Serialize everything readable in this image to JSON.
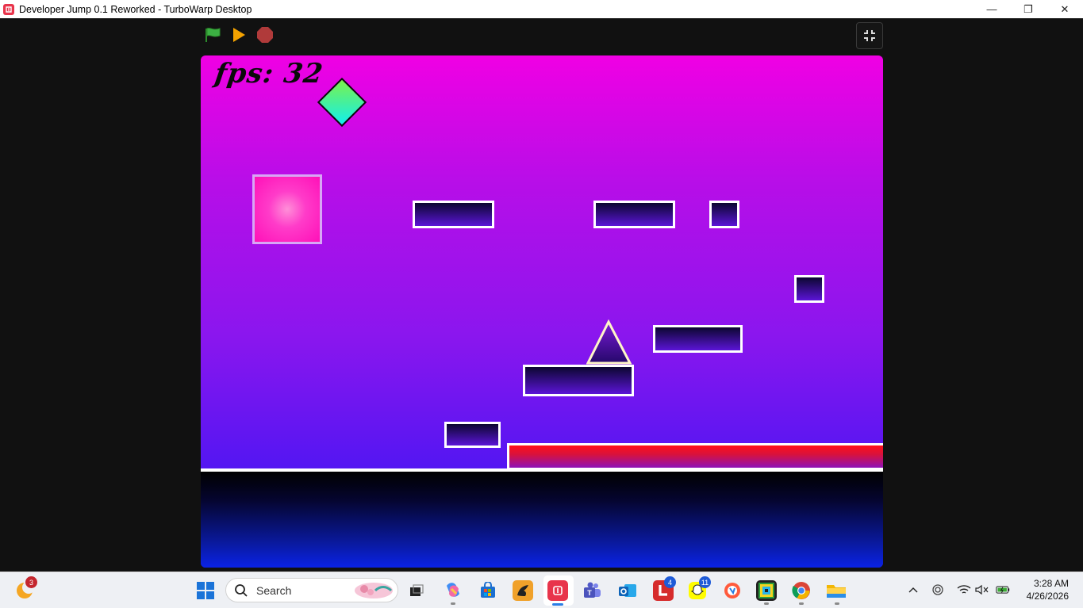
{
  "window": {
    "title": "Developer Jump 0.1 Reworked - TurboWarp Desktop",
    "minimize_glyph": "—",
    "maximize_glyph": "❐",
    "close_glyph": "✕"
  },
  "controls": {
    "green_flag": "green-flag-icon",
    "play": "play-icon",
    "stop": "stop-icon",
    "fullscreen": "exit-fullscreen-icon"
  },
  "stage": {
    "fps_label": "fps: 32",
    "colors": {
      "sky_top": "#f000e4",
      "sky_bottom": "#2b12f5",
      "player_a": "#7cf14a",
      "player_b": "#10f0ee",
      "orb": "#ff10b8",
      "lava": "#ff0f1a"
    }
  },
  "taskbar": {
    "weather_badge": "3",
    "search_placeholder": "Search",
    "outlook_badge": "",
    "l_badge": "4",
    "snap_badge": "11",
    "time": "3:28 AM",
    "date": "4/26/2026"
  }
}
